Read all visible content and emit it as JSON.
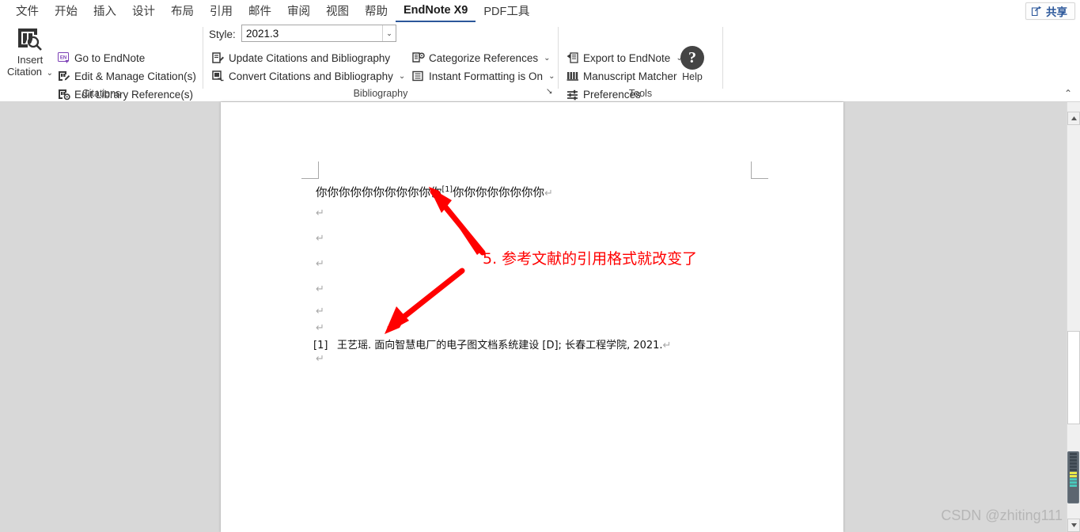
{
  "tabs": [
    {
      "label": "文件",
      "active": false
    },
    {
      "label": "开始",
      "active": false
    },
    {
      "label": "插入",
      "active": false
    },
    {
      "label": "设计",
      "active": false
    },
    {
      "label": "布局",
      "active": false
    },
    {
      "label": "引用",
      "active": false
    },
    {
      "label": "邮件",
      "active": false
    },
    {
      "label": "审阅",
      "active": false
    },
    {
      "label": "视图",
      "active": false
    },
    {
      "label": "帮助",
      "active": false
    },
    {
      "label": "EndNote X9",
      "active": true
    },
    {
      "label": "PDF工具",
      "active": false
    }
  ],
  "share": {
    "label": "共享",
    "icon": "share-icon"
  },
  "ribbon": {
    "citations": {
      "group_label": "Citations",
      "insert": {
        "line1": "Insert",
        "line2": "Citation",
        "caret": "⌄",
        "icon": "insert-citation-icon"
      },
      "items": [
        {
          "label": "Go to EndNote",
          "icon": "endnote-logo-icon"
        },
        {
          "label": "Edit & Manage Citation(s)",
          "icon": "edit-citation-icon"
        },
        {
          "label": "Edit Library Reference(s)",
          "icon": "library-reference-icon"
        }
      ]
    },
    "bibliography": {
      "group_label": "Bibliography",
      "style_label": "Style:",
      "style_value": "2021.3",
      "style_caret": "⌄",
      "items": [
        {
          "label": "Update Citations and Bibliography",
          "icon": "update-bibliography-icon",
          "caret": ""
        },
        {
          "label": "Convert Citations and Bibliography",
          "icon": "convert-bibliography-icon",
          "caret": "⌄"
        },
        {
          "label": "Categorize References",
          "icon": "categorize-references-icon",
          "caret": "⌄"
        },
        {
          "label": "Instant Formatting is On",
          "icon": "instant-formatting-icon",
          "caret": "⌄"
        }
      ],
      "dialog_launcher": "⭨"
    },
    "tools": {
      "group_label": "Tools",
      "items": [
        {
          "label": "Export to EndNote",
          "icon": "export-endnote-icon",
          "caret": "⌄"
        },
        {
          "label": "Manuscript Matcher",
          "icon": "manuscript-matcher-icon",
          "caret": ""
        },
        {
          "label": "Preferences",
          "icon": "preferences-icon",
          "caret": ""
        }
      ],
      "help": {
        "label": "Help",
        "glyph": "?",
        "icon": "help-icon"
      }
    },
    "collapse_caret": "⌃"
  },
  "document": {
    "body_line": {
      "before": "你你你你你你你你你你你",
      "citation": "[1]",
      "after": "你你你你你你你你",
      "pilcrow": "↵"
    },
    "empty_paragraphs": [
      "↵",
      "↵",
      "↵",
      "↵",
      "↵",
      "↵"
    ],
    "reference": {
      "number": "[1]",
      "text": "王艺瑶. 面向智慧电厂的电子图文档系统建设 [D]; 长春工程学院, 2021.",
      "pilcrow": "↵"
    },
    "trailing_pilcrow": "↵"
  },
  "annotation": {
    "text": "5. 参考文献的引用格式就改变了",
    "color": "#ff0000"
  },
  "scrollbar": {
    "up_arrow": "▲",
    "down_arrow": "▼",
    "splitter_caret": "⌃"
  },
  "watermark": "CSDN @zhiting111"
}
